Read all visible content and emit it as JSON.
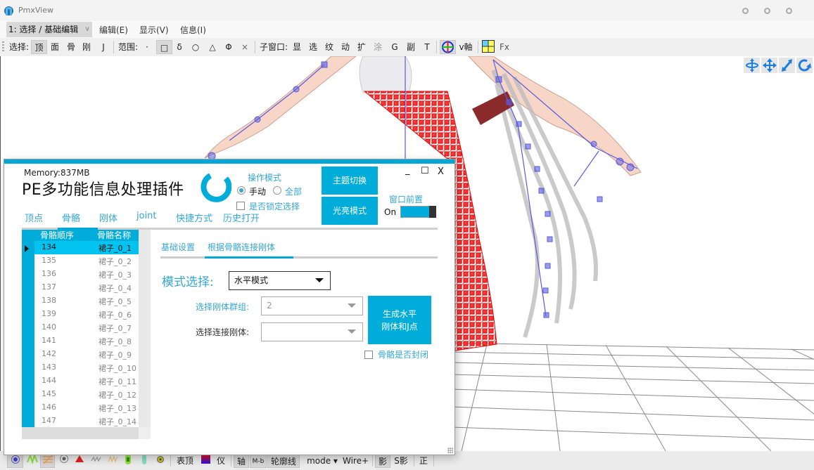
{
  "app": {
    "title": "PmxView",
    "colors": {
      "accent": "#00acd9",
      "accent_text": "#35a7d3",
      "rigid_body": "#e8262a",
      "bone": "#5a5ae0"
    }
  },
  "menubar": {
    "mode_select": "1: 选择 / 基础编辑",
    "items": [
      "编辑(E)",
      "显示(V)",
      "信息(I)"
    ]
  },
  "toolbar": {
    "select_label": "选择:",
    "select_items": [
      "顶",
      "面",
      "骨",
      "刚",
      "J"
    ],
    "range_label": "范围:",
    "range_items": [
      "·",
      "□",
      "δ",
      "○",
      "△",
      "Φ",
      "×"
    ],
    "subwindow_label": "子窗口:",
    "subwindow_items": [
      "显",
      "选",
      "纹",
      "动",
      "扩",
      "涂",
      "G",
      "副",
      "T"
    ],
    "axis_label": "v軸",
    "fx_label": "Fx"
  },
  "viewport": {
    "nav_icons": [
      "rotate-axis-icon",
      "move-icon",
      "zoom-icon",
      "reset-rotation-icon"
    ]
  },
  "bottombar": {
    "icons": [
      "vertex-point-icon",
      "green-texture-icon",
      "orange-texture-icon",
      "radio-dot-icon",
      "red-triangle-icon",
      "grey-zigzag-icon",
      "yellow-zigzag-icon",
      "green-capsule-icon",
      "teal-capsule-icon",
      "yellow-gear-icon"
    ],
    "labels": [
      "表顶",
      "仪",
      "轴",
      "M-b",
      "轮廓线",
      "mode ▾",
      "Wire+",
      "影",
      "S影",
      "正"
    ]
  },
  "plugin": {
    "memory": "Memory:837MB",
    "title": "PE多功能信息处理插件",
    "op_mode": {
      "title": "操作模式",
      "options": [
        "手动",
        "全部"
      ],
      "selected": "手动",
      "lock_label": "是否锁定选择",
      "lock_checked": false
    },
    "buttons": {
      "theme": "主题切换",
      "bright": "光亮模式"
    },
    "window_front": {
      "title": "窗口前置",
      "state": "On"
    },
    "window_controls": {
      "minimize": "_",
      "maximize": "☐",
      "close": "X"
    },
    "nav_tabs": [
      "顶点",
      "骨骼",
      "刚体",
      "joint",
      "快捷方式",
      "历史打开"
    ],
    "active_nav_tab": "骨骼",
    "grid": {
      "columns": [
        "骨骼顺序",
        "骨骼名称"
      ],
      "selected_index": 0,
      "rows": [
        [
          "134",
          "裙子_0_1"
        ],
        [
          "135",
          "裙子_0_2"
        ],
        [
          "136",
          "裙子_0_3"
        ],
        [
          "137",
          "裙子_0_4"
        ],
        [
          "138",
          "裙子_0_5"
        ],
        [
          "139",
          "裙子_0_6"
        ],
        [
          "140",
          "裙子_0_7"
        ],
        [
          "141",
          "裙子_0_8"
        ],
        [
          "142",
          "裙子_0_9"
        ],
        [
          "143",
          "裙子_0_10"
        ],
        [
          "144",
          "裙子_0_11"
        ],
        [
          "145",
          "裙子_0_12"
        ],
        [
          "146",
          "裙子_0_13"
        ],
        [
          "147",
          "裙子_0_14"
        ]
      ]
    },
    "sub_tabs": [
      "基础设置",
      "根据骨骼连接刚体"
    ],
    "active_sub_tab": "根据骨骼连接刚体",
    "mode_label": "模式选择:",
    "mode_value": "水平模式",
    "group_label": "选择刚体群组:",
    "group_value": "2",
    "connect_label": "选择连接刚体:",
    "connect_value": "",
    "generate_button": "生成水平\n刚体和J点",
    "generate_line1": "生成水平",
    "generate_line2": "刚体和J点",
    "closed_label": "骨骼是否封闭",
    "closed_checked": false
  }
}
